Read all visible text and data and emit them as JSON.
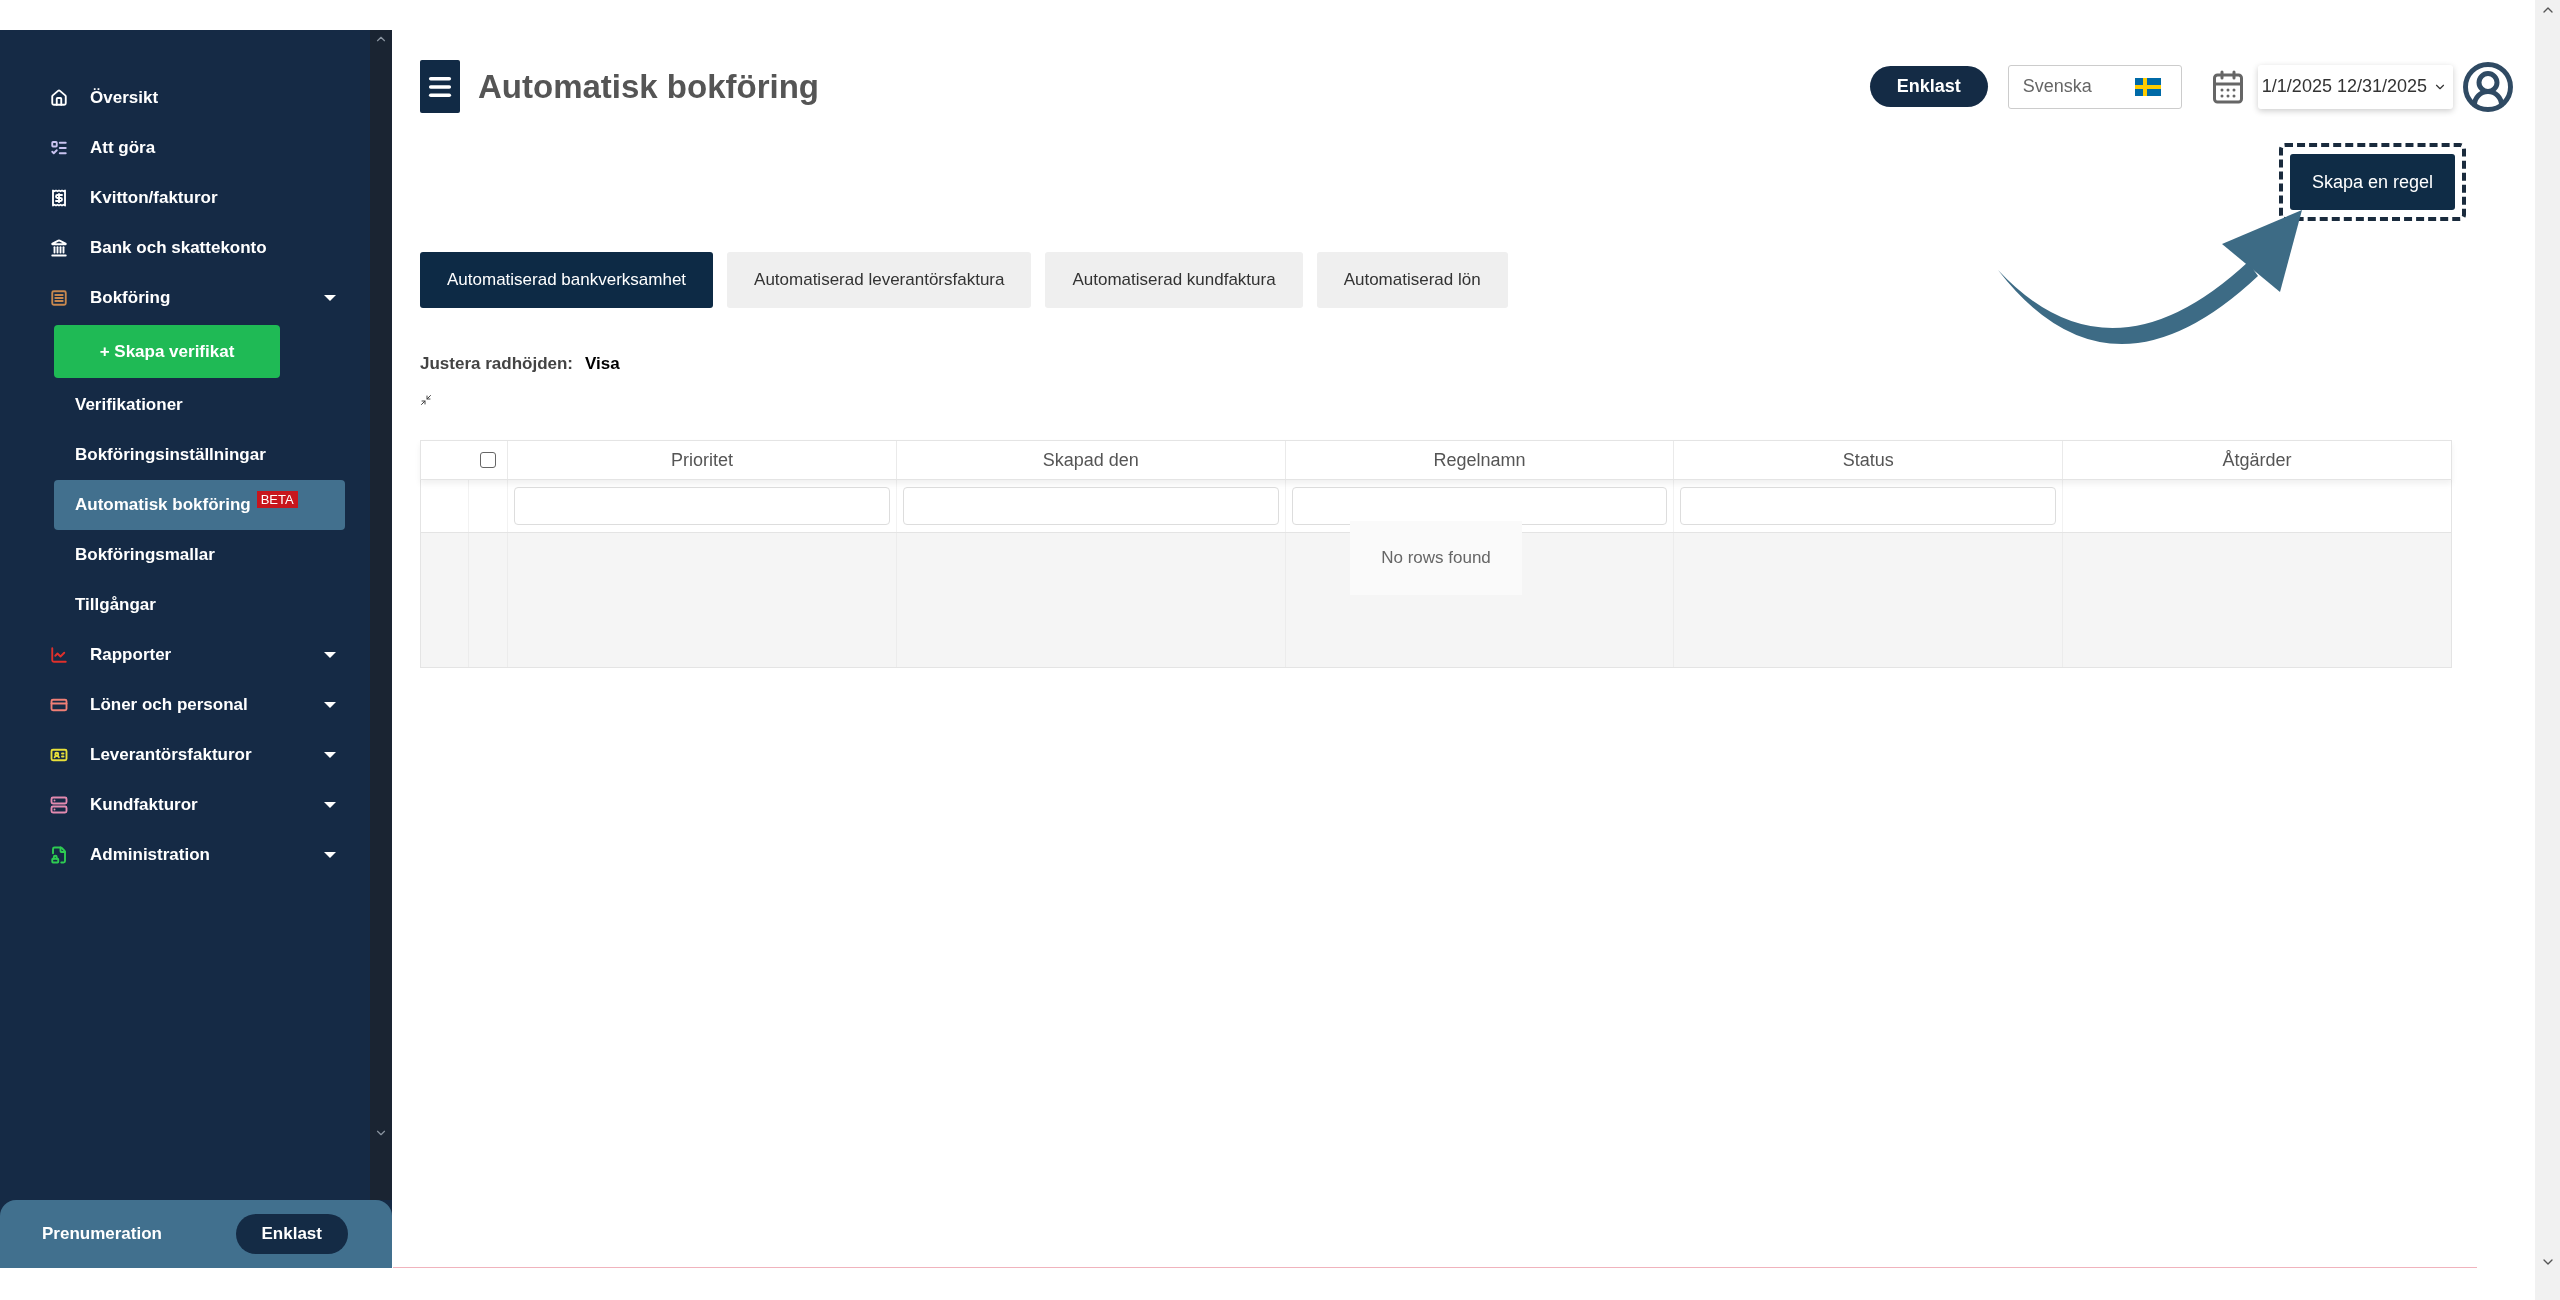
{
  "sidebar": {
    "items": [
      {
        "label": "Översikt",
        "color": "#ffffff",
        "expandable": false
      },
      {
        "label": "Att göra",
        "color": "#c9c3f0",
        "expandable": false
      },
      {
        "label": "Kvitton/fakturor",
        "color": "#ffffff",
        "expandable": false
      },
      {
        "label": "Bank och skattekonto",
        "color": "#ffffff",
        "expandable": false
      },
      {
        "label": "Bokföring",
        "color": "#c8884f",
        "expandable": true,
        "children": [
          {
            "kind": "button",
            "label": "+ Skapa verifikat"
          },
          {
            "kind": "link",
            "label": "Verifikationer",
            "selected": false
          },
          {
            "kind": "link",
            "label": "Bokföringsinställningar",
            "selected": false
          },
          {
            "kind": "link",
            "label": "Automatisk bokföring",
            "badge": "BETA",
            "selected": true
          },
          {
            "kind": "link",
            "label": "Bokföringsmallar",
            "selected": false
          },
          {
            "kind": "link",
            "label": "Tillgångar",
            "selected": false
          }
        ]
      },
      {
        "label": "Rapporter",
        "color": "#e0302b",
        "expandable": true
      },
      {
        "label": "Löner och personal",
        "color": "#f07f76",
        "expandable": true
      },
      {
        "label": "Leverantörsfakturor",
        "color": "#e8e03a",
        "expandable": true
      },
      {
        "label": "Kundfakturor",
        "color": "#e38ab0",
        "expandable": true
      },
      {
        "label": "Administration",
        "color": "#2ecc52",
        "expandable": true
      }
    ],
    "footer": {
      "label": "Prenumeration",
      "plan": "Enklast"
    }
  },
  "header": {
    "title": "Automatisk bokföring",
    "plan": "Enklast",
    "language": "Svenska",
    "date_range": "1/1/2025 12/31/2025"
  },
  "action_button": {
    "label": "Skapa en regel",
    "highlighted": true
  },
  "tabs": [
    {
      "label": "Automatiserad bankverksamhet",
      "selected": true
    },
    {
      "label": "Automatiserad leverantörsfaktura",
      "selected": false
    },
    {
      "label": "Automatiserad kundfaktura",
      "selected": false
    },
    {
      "label": "Automatiserad lön",
      "selected": false
    }
  ],
  "row_height": {
    "label": "Justera radhöjden:",
    "value": "Visa"
  },
  "table": {
    "select_all_checked": false,
    "columns": [
      {
        "label": "Prioritet",
        "filterable": true
      },
      {
        "label": "Skapad den",
        "filterable": true
      },
      {
        "label": "Regelnamn",
        "filterable": true
      },
      {
        "label": "Status",
        "filterable": true
      },
      {
        "label": "Åtgärder",
        "filterable": false
      }
    ],
    "empty_message": "No rows found"
  }
}
